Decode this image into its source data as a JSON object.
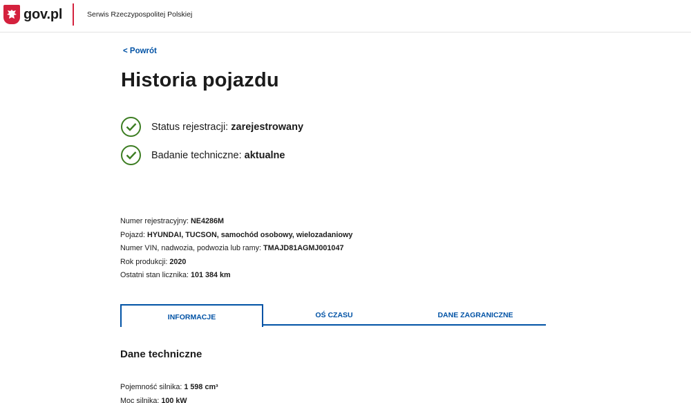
{
  "header": {
    "logo_text": "gov.pl",
    "service_name": "Serwis Rzeczypospolitej Polskiej"
  },
  "back_link": "< Powrót",
  "page_title": "Historia pojazdu",
  "status": [
    {
      "label": "Status rejestracji:",
      "value": "zarejestrowany"
    },
    {
      "label": "Badanie techniczne:",
      "value": "aktualne"
    }
  ],
  "vehicle": [
    {
      "label": "Numer rejestracyjny:",
      "value": "NE4286M"
    },
    {
      "label": "Pojazd:",
      "value": "HYUNDAI, TUCSON, samochód osobowy, wielozadaniowy"
    },
    {
      "label": "Numer VIN, nadwozia, podwozia lub ramy:",
      "value": "TMAJD81AGMJ001047"
    },
    {
      "label": "Rok produkcji:",
      "value": "2020"
    },
    {
      "label": "Ostatni stan licznika:",
      "value": "101 384 km"
    }
  ],
  "tabs": [
    "INFORMACJE",
    "OŚ CZASU",
    "DANE ZAGRANICZNE"
  ],
  "section_title": "Dane techniczne",
  "technical": [
    {
      "label": "Pojemność silnika:",
      "value": "1 598 cm³"
    },
    {
      "label": "Moc silnika:",
      "value": "100 kW"
    }
  ],
  "colors": {
    "accent": "#0052a5",
    "brand_red": "#d4213d",
    "ok_green": "#3c7d22"
  },
  "icons": {
    "logo": "polish-eagle-icon",
    "status": "check-circle-icon"
  }
}
